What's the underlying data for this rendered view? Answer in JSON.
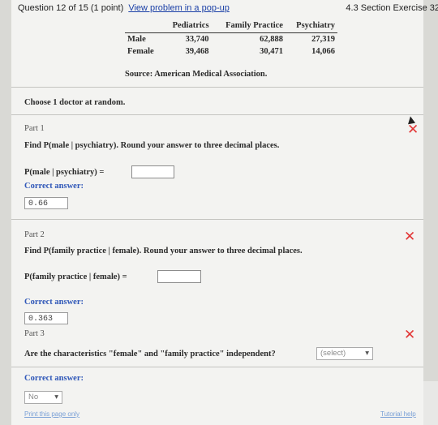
{
  "header": {
    "question": "Question 12 of 15 (1 point)",
    "popup_link": "View problem in a pop-up",
    "section": "4.3 Section Exercise 32"
  },
  "table": {
    "headers": [
      "",
      "Pediatrics",
      "Family Practice",
      "Psychiatry"
    ],
    "rows": [
      [
        "Male",
        "33,740",
        "62,888",
        "27,319"
      ],
      [
        "Female",
        "39,468",
        "30,471",
        "14,066"
      ]
    ],
    "source": "Source: American Medical Association."
  },
  "intro": "Choose 1 doctor at random.",
  "part1": {
    "title": "Part 1",
    "prompt": "Find P(male | psychiatry). Round your answer to three decimal places.",
    "input_label": "P(male | psychiatry) =",
    "correct_label": "Correct answer:",
    "answer": "0.66"
  },
  "part2": {
    "title": "Part 2",
    "prompt": "Find P(family practice | female). Round your answer to three decimal places.",
    "input_label": "P(family practice | female) =",
    "correct_label": "Correct answer:",
    "answer": "0.363"
  },
  "part3": {
    "title": "Part 3",
    "prompt": "Are the characteristics \"female\" and \"family practice\" independent?",
    "select_placeholder": "(select)",
    "correct_label": "Correct answer:",
    "answer": "No"
  },
  "footer": {
    "print_link": "Print this page only",
    "tutorial_link": "Tutorial help"
  },
  "icons": {
    "incorrect": "x-mark-icon",
    "dropdown": "chevron-down-icon"
  },
  "colors": {
    "incorrect": "#e23636",
    "correct_label": "#2f57b8",
    "link": "#1a3fa6"
  }
}
